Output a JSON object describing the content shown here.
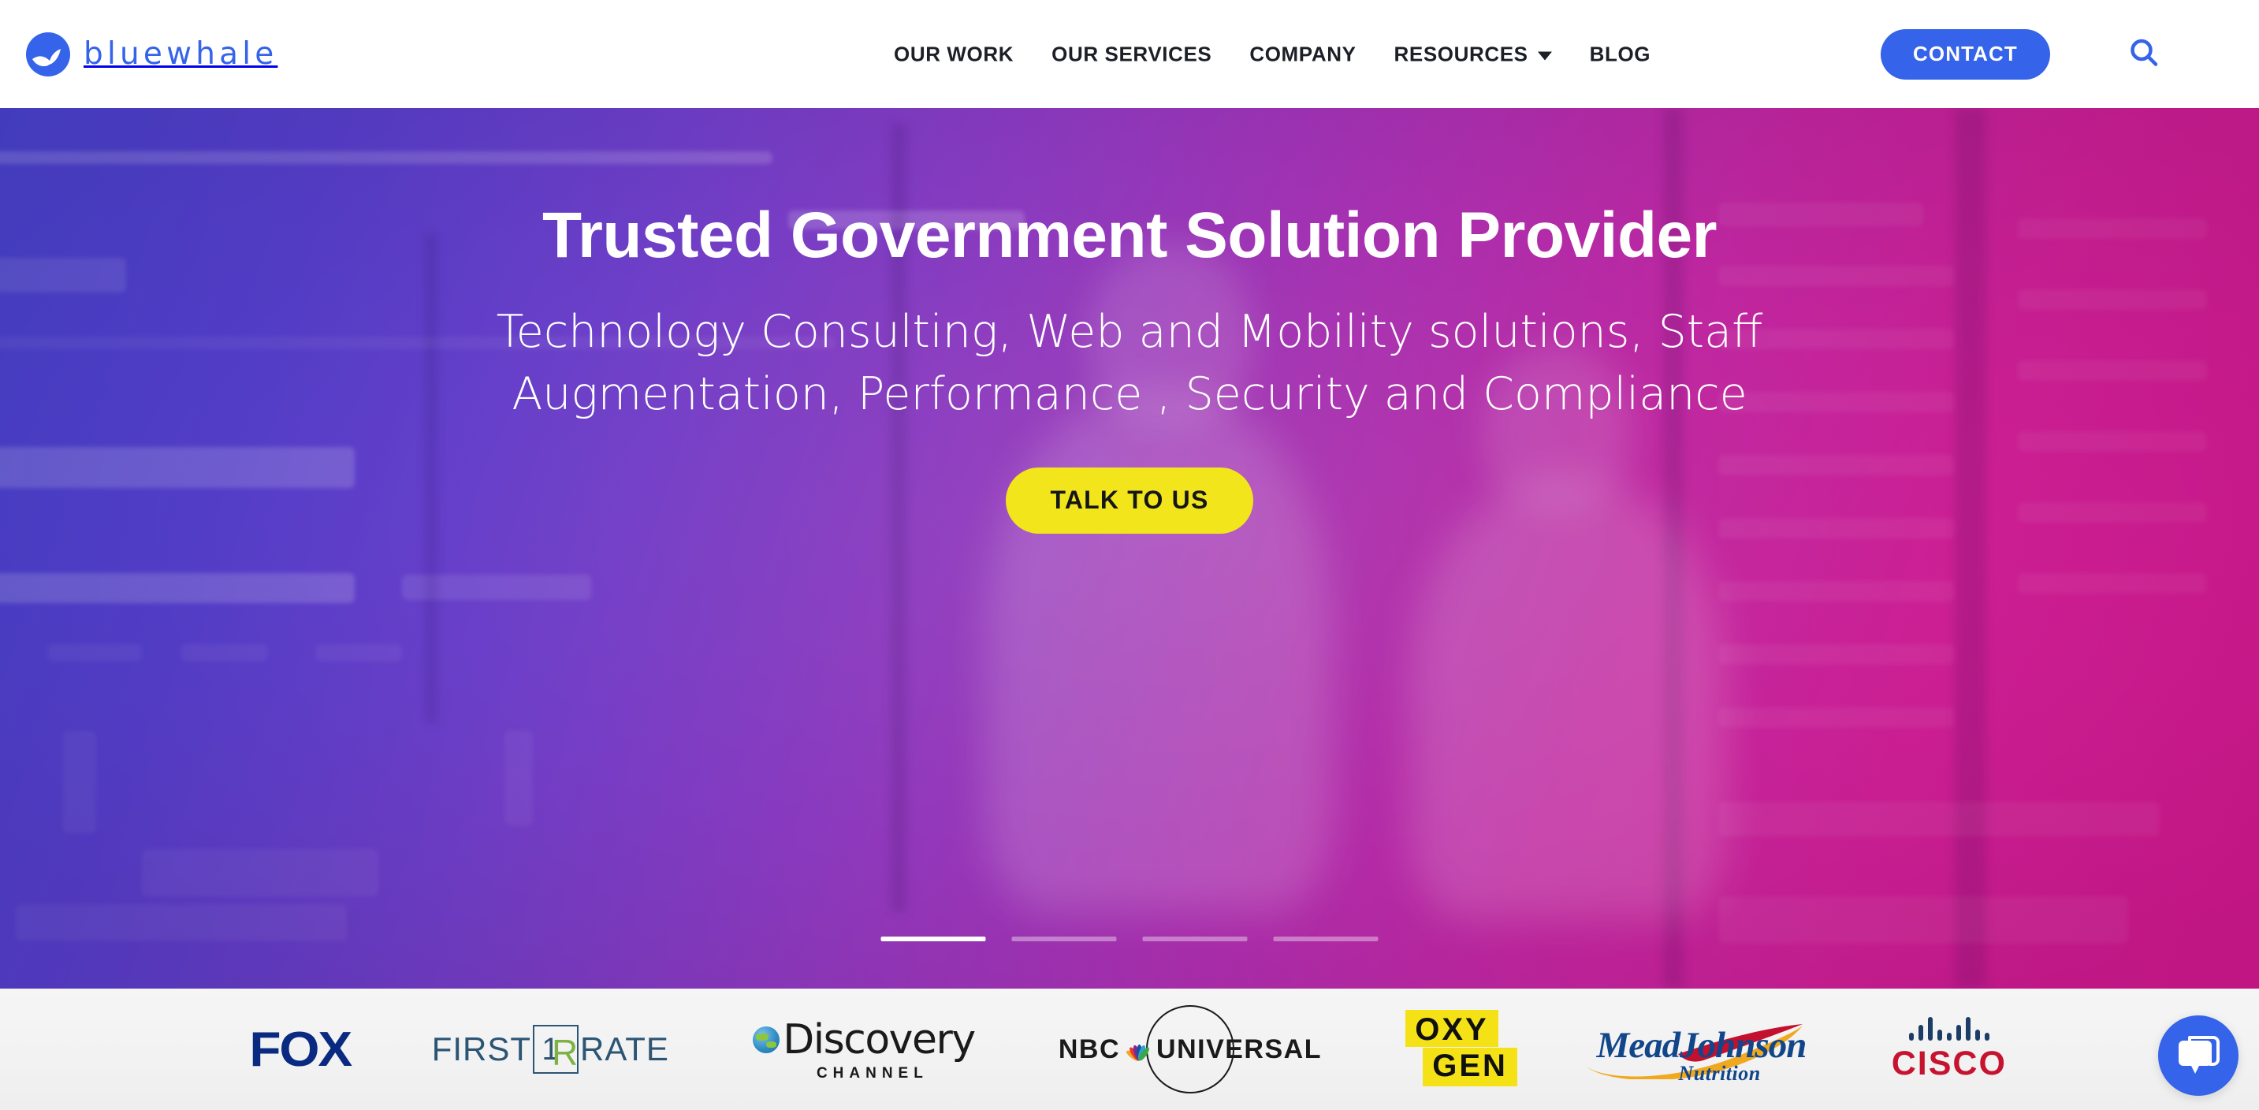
{
  "header": {
    "logo": {
      "text": "bluewhale",
      "icon": "whale-tail-icon",
      "color": "#3563e9"
    },
    "nav": [
      {
        "label": "OUR WORK",
        "has_dropdown": false
      },
      {
        "label": "OUR SERVICES",
        "has_dropdown": false
      },
      {
        "label": "COMPANY",
        "has_dropdown": false
      },
      {
        "label": "RESOURCES",
        "has_dropdown": true
      },
      {
        "label": "BLOG",
        "has_dropdown": false
      }
    ],
    "contact_label": "CONTACT",
    "search_icon": "search-icon",
    "menu_icon": "hamburger-menu-icon"
  },
  "hero": {
    "title": "Trusted Government Solution Provider",
    "subtitle": "Technology Consulting, Web and Mobility solutions, Staff Augmentation, Performance , Security and Compliance",
    "cta_label": "TALK TO US",
    "cta_color": "#f2e51c",
    "gradient_from": "#4344cf",
    "gradient_to": "#d3188c",
    "carousel": {
      "slides": 4,
      "active_index": 0
    }
  },
  "logo_strip": {
    "background": "#f2f2f2",
    "brands": [
      {
        "name": "FOX",
        "label": "FOX",
        "color": "#0a2a82"
      },
      {
        "name": "First Rate",
        "word1": "FIRST",
        "mark1": "1",
        "mark2": "R",
        "word2": "RATE",
        "color": "#2c5574",
        "accent": "#7cb342"
      },
      {
        "name": "Discovery Channel",
        "word": "Discovery",
        "sub": "CHANNEL",
        "color": "#1a1a1a"
      },
      {
        "name": "NBC Universal",
        "word1": "NBC",
        "word2": "UNIVERSAL",
        "color": "#1a1a1a"
      },
      {
        "name": "Oxygen",
        "line1": "OXY",
        "line2": "GEN",
        "color": "#f5e216"
      },
      {
        "name": "Mead Johnson Nutrition",
        "word": "MeadJohnson",
        "sub": "Nutrition",
        "color": "#11468a"
      },
      {
        "name": "Cisco",
        "word": "CISCO",
        "color": "#c6132f"
      }
    ]
  },
  "chat": {
    "icon": "chat-bubble-icon",
    "color": "#3563e9"
  }
}
